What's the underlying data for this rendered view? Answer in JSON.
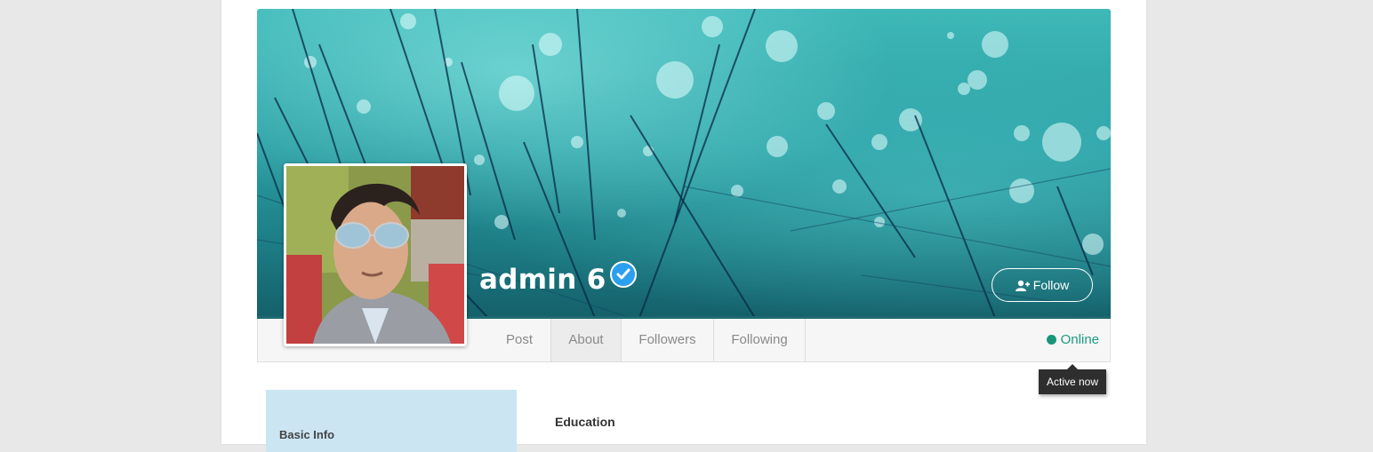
{
  "profile": {
    "name": "admin 6",
    "follow_label": "Follow",
    "status": "Online",
    "status_tooltip": "Active now"
  },
  "tabs": [
    {
      "label": "Post"
    },
    {
      "label": "About"
    },
    {
      "label": "Followers"
    },
    {
      "label": "Following"
    }
  ],
  "sections": {
    "basic_info": "Basic Info",
    "education": "Education"
  },
  "colors": {
    "accent_online": "#17967a",
    "verified": "#2d9ff0",
    "basic_info_bg": "#cbe5f3"
  }
}
